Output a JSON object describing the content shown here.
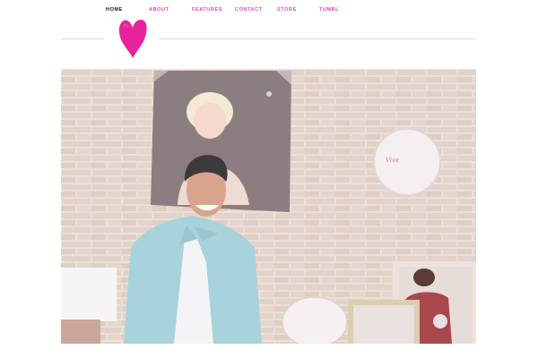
{
  "nav": {
    "items": [
      {
        "label": "HOME",
        "active": true
      },
      {
        "label": "ABOUT",
        "active": false
      },
      {
        "label": "FEATURES",
        "active": false
      },
      {
        "label": "CONTACT",
        "active": false
      },
      {
        "label": "STORE",
        "active": false
      },
      {
        "label": "TUMBL",
        "active": false
      }
    ]
  },
  "logo": {
    "icon": "heart-icon",
    "color": "#e8229a"
  },
  "colors": {
    "nav_link": "#e040c8",
    "nav_active": "#111111",
    "divider": "#dedede"
  }
}
